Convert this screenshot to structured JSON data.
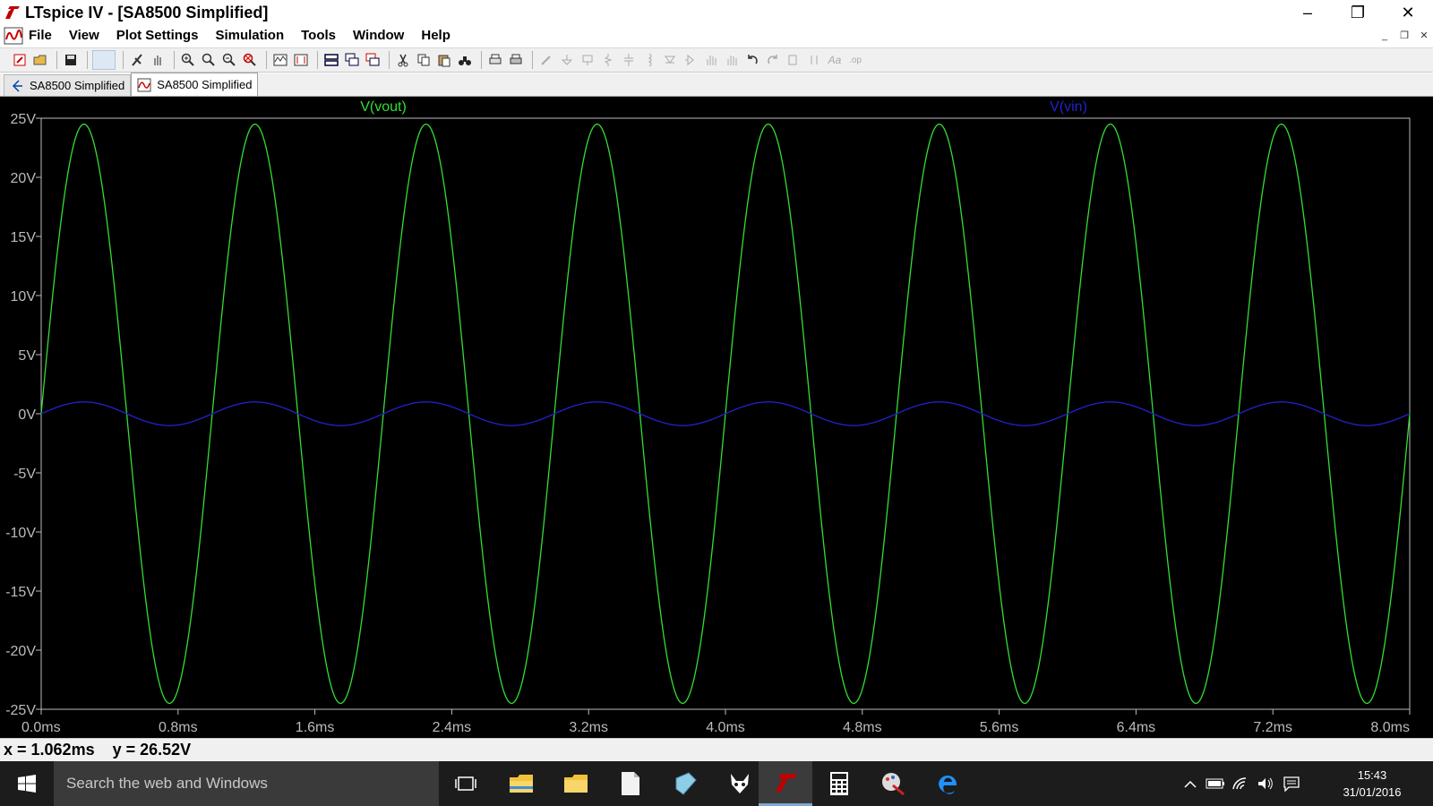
{
  "window": {
    "title": "LTspice IV - [SA8500 Simplified]",
    "controls": {
      "minimize": "–",
      "restore": "❐",
      "close": "✕"
    }
  },
  "menu": [
    "File",
    "View",
    "Plot Settings",
    "Simulation",
    "Tools",
    "Window",
    "Help"
  ],
  "tabs": [
    {
      "label": "SA8500 Simplified",
      "icon": "schematic-icon",
      "active": false
    },
    {
      "label": "SA8500 Simplified",
      "icon": "waveform-icon",
      "active": true
    }
  ],
  "plot": {
    "background": "#000000",
    "traces": [
      {
        "name": "V(vout)",
        "color": "#33dd33"
      },
      {
        "name": "V(vin)",
        "color": "#2222cc"
      }
    ]
  },
  "chart_data": {
    "type": "line",
    "xlabel": "",
    "ylabel": "",
    "xlim": [
      0,
      8
    ],
    "ylim": [
      -25,
      25
    ],
    "x_ticks": [
      "0.0ms",
      "0.8ms",
      "1.6ms",
      "2.4ms",
      "3.2ms",
      "4.0ms",
      "4.8ms",
      "5.6ms",
      "6.4ms",
      "7.2ms",
      "8.0ms"
    ],
    "y_ticks": [
      "25V",
      "20V",
      "15V",
      "10V",
      "5V",
      "0V",
      "-5V",
      "-10V",
      "-15V",
      "-20V",
      "-25V"
    ],
    "series": [
      {
        "name": "V(vout)",
        "color": "#33dd33",
        "shape": "sine",
        "amplitude": 24.5,
        "frequency_khz": 1.0,
        "phase": "sin"
      },
      {
        "name": "V(vin)",
        "color": "#2222cc",
        "shape": "sine",
        "amplitude": 1.0,
        "frequency_khz": 1.0,
        "phase": "sin"
      }
    ]
  },
  "status": {
    "cursor": "x = 1.062ms    y = 26.52V"
  },
  "taskbar": {
    "search_placeholder": "Search the web and Windows",
    "time": "15:43",
    "date": "31/01/2016"
  }
}
